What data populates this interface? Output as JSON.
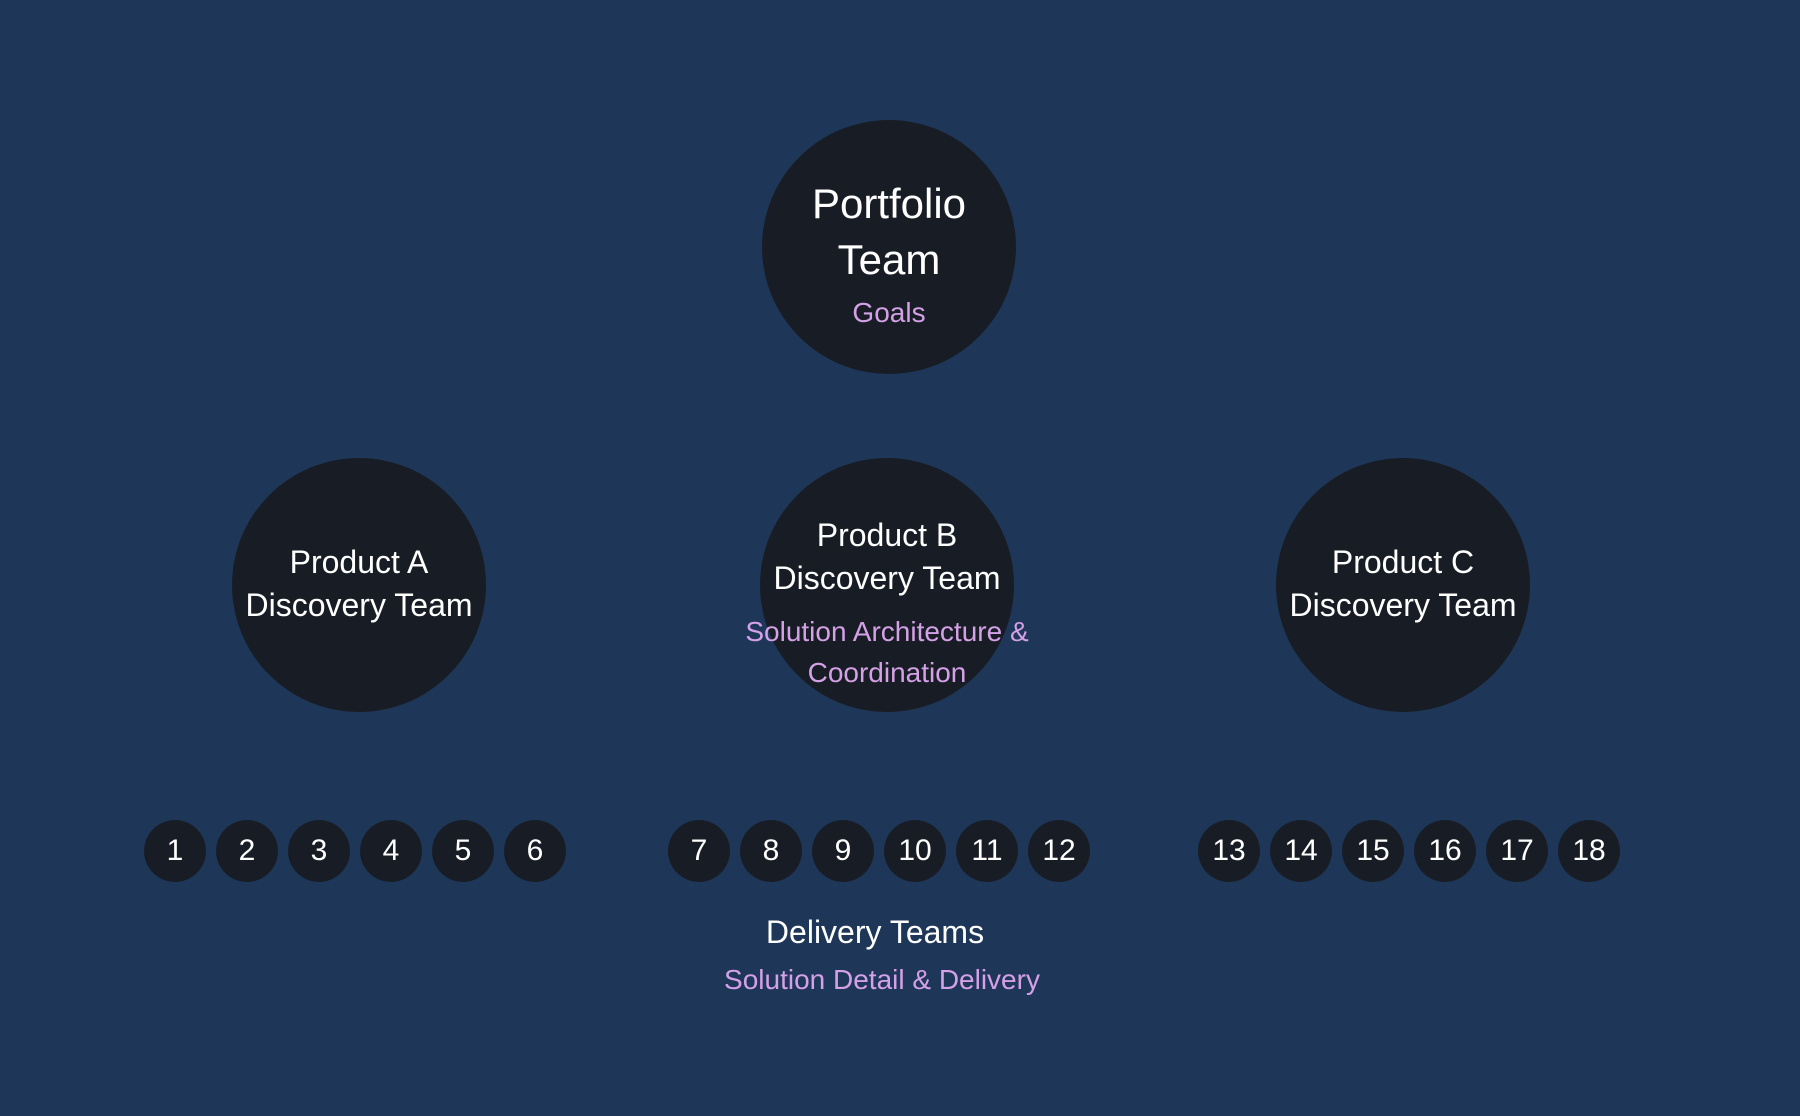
{
  "portfolio": {
    "title_line1": "Portfolio",
    "title_line2": "Team",
    "subtitle": "Goals"
  },
  "products": [
    {
      "line1": "Product A",
      "line2": "Discovery Team"
    },
    {
      "line1": "Product B",
      "line2": "Discovery Team",
      "subtitle_line1": "Solution Architecture &",
      "subtitle_line2": "Coordination"
    },
    {
      "line1": "Product C",
      "line2": "Discovery Team"
    }
  ],
  "teams": [
    "1",
    "2",
    "3",
    "4",
    "5",
    "6",
    "7",
    "8",
    "9",
    "10",
    "11",
    "12",
    "13",
    "14",
    "15",
    "16",
    "17",
    "18"
  ],
  "delivery": {
    "title": "Delivery Teams",
    "subtitle": "Solution Detail & Delivery"
  },
  "colors": {
    "background": "#1e3658",
    "node": "#181d25",
    "text": "#ffffff",
    "accent": "#d4a0e6"
  }
}
